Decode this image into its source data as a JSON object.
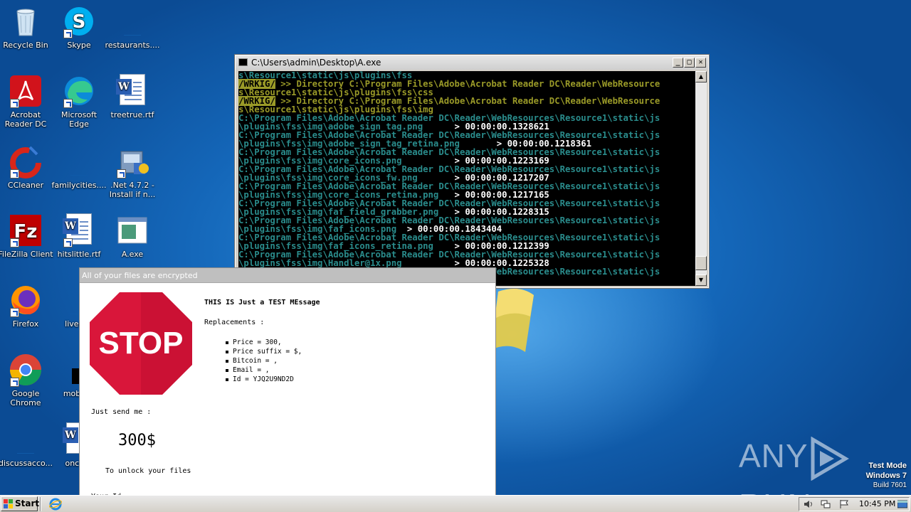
{
  "desktop": {
    "icons": [
      {
        "label": "Recycle Bin",
        "icon": "recycle-bin-icon"
      },
      {
        "label": "Skype",
        "icon": "skype-icon"
      },
      {
        "label": "restaurants....",
        "icon": "blank-file-icon"
      },
      {
        "label": "Acrobat Reader DC",
        "icon": "acrobat-reader-icon"
      },
      {
        "label": "Microsoft Edge",
        "icon": "edge-icon"
      },
      {
        "label": "treetrue.rtf",
        "icon": "word-doc-icon"
      },
      {
        "label": "CCleaner",
        "icon": "ccleaner-icon"
      },
      {
        "label": "familycities....",
        "icon": "blank-file-icon"
      },
      {
        "label": ".Net 4.7.2 - Install if n...",
        "icon": "installer-icon"
      },
      {
        "label": "FileZilla Client",
        "icon": "filezilla-icon"
      },
      {
        "label": "hitslittle.rtf",
        "icon": "word-doc-icon"
      },
      {
        "label": "A.exe",
        "icon": "exe-window-icon"
      },
      {
        "label": "Firefox",
        "icon": "firefox-icon"
      },
      {
        "label": "liveenv",
        "icon": "blank-file-icon"
      },
      {
        "label": "Google Chrome",
        "icon": "chrome-icon"
      },
      {
        "label": "mobiled",
        "icon": "black-file-icon"
      },
      {
        "label": "discussacco...",
        "icon": "blank-file-icon"
      },
      {
        "label": "oncese",
        "icon": "word-doc-icon"
      }
    ]
  },
  "console": {
    "title": "C:\\Users\\admin\\Desktop\\A.exe",
    "lines": [
      {
        "tag": "",
        "text": "s\\Resource1\\static\\js\\plugins\\fss",
        "color": "teal"
      },
      {
        "tag": "/WRKIG/",
        "text": " >> Directory C:\\Program Files\\Adobe\\Acrobat Reader DC\\Reader\\WebResource",
        "color": "olive"
      },
      {
        "tag": "",
        "text": "s\\Resource1\\static\\js\\plugins\\fss\\css",
        "color": "olive"
      },
      {
        "tag": "/WRKIG/",
        "text": " >> Directory C:\\Program Files\\Adobe\\Acrobat Reader DC\\Reader\\WebResource",
        "color": "olive"
      },
      {
        "tag": "",
        "text": "s\\Resource1\\static\\js\\plugins\\fss\\img",
        "color": "olive"
      },
      {
        "tag": "",
        "text": "C:\\Program Files\\Adobe\\Acrobat Reader DC\\Reader\\WebResources\\Resource1\\static\\js",
        "color": "teal"
      },
      {
        "tag": "",
        "text": "\\plugins\\fss\\img\\adobe_sign_tag.png",
        "color": "teal",
        "time": "      > 00:00:00.1328621"
      },
      {
        "tag": "",
        "text": "C:\\Program Files\\Adobe\\Acrobat Reader DC\\Reader\\WebResources\\Resource1\\static\\js",
        "color": "teal"
      },
      {
        "tag": "",
        "text": "\\plugins\\fss\\img\\adobe_sign_tag_retina.png",
        "color": "teal",
        "time": "       > 00:00:00.1218361"
      },
      {
        "tag": "",
        "text": "C:\\Program Files\\Adobe\\Acrobat Reader DC\\Reader\\WebResources\\Resource1\\static\\js",
        "color": "teal"
      },
      {
        "tag": "",
        "text": "\\plugins\\fss\\img\\core_icons.png",
        "color": "teal",
        "time": "          > 00:00:00.1223169"
      },
      {
        "tag": "",
        "text": "C:\\Program Files\\Adobe\\Acrobat Reader DC\\Reader\\WebResources\\Resource1\\static\\js",
        "color": "teal"
      },
      {
        "tag": "",
        "text": "\\plugins\\fss\\img\\core_icons_fw.png",
        "color": "teal",
        "time": "       > 00:00:00.1217207"
      },
      {
        "tag": "",
        "text": "C:\\Program Files\\Adobe\\Acrobat Reader DC\\Reader\\WebResources\\Resource1\\static\\js",
        "color": "teal"
      },
      {
        "tag": "",
        "text": "\\plugins\\fss\\img\\core_icons_retina.png",
        "color": "teal",
        "time": "   > 00:00:00.1217165"
      },
      {
        "tag": "",
        "text": "C:\\Program Files\\Adobe\\Acrobat Reader DC\\Reader\\WebResources\\Resource1\\static\\js",
        "color": "teal"
      },
      {
        "tag": "",
        "text": "\\plugins\\fss\\img\\faf_field_grabber.png",
        "color": "teal",
        "time": "   > 00:00:00.1228315"
      },
      {
        "tag": "",
        "text": "C:\\Program Files\\Adobe\\Acrobat Reader DC\\Reader\\WebResources\\Resource1\\static\\js",
        "color": "teal"
      },
      {
        "tag": "",
        "text": "\\plugins\\fss\\img\\faf_icons.png",
        "color": "teal",
        "time": "  > 00:00:00.1843404"
      },
      {
        "tag": "",
        "text": "C:\\Program Files\\Adobe\\Acrobat Reader DC\\Reader\\WebResources\\Resource1\\static\\js",
        "color": "teal"
      },
      {
        "tag": "",
        "text": "\\plugins\\fss\\img\\faf_icons_retina.png",
        "color": "teal",
        "time": "    > 00:00:00.1212399"
      },
      {
        "tag": "",
        "text": "C:\\Program Files\\Adobe\\Acrobat Reader DC\\Reader\\WebResources\\Resource1\\static\\js",
        "color": "teal"
      },
      {
        "tag": "",
        "text": "\\plugins\\fss\\img\\Handler@1x.png",
        "color": "teal",
        "time": "          > 00:00:00.1225328"
      },
      {
        "tag": "",
        "text": "C:\\Program Files\\Adobe\\Acrobat Reader DC\\Reader\\WebResources\\Resource1\\static\\js",
        "color": "teal"
      }
    ],
    "colors": {
      "teal": "#2a8c8c",
      "olive": "#9a9a28",
      "white": "#ffffff"
    }
  },
  "ransom": {
    "title": "All of your files are encrypted",
    "stop_sign_text": "STOP",
    "message": "THIS IS Just a TEST MEssage",
    "replacements_label": "Replacements :",
    "replacements": [
      "Price = 300,",
      "Price suffix = $,",
      "Bitcoin = ,",
      "Email = ,",
      "Id = YJQ2U9ND2D"
    ],
    "send_label": "Just send me :",
    "amount": "300$",
    "unlock_text": "To unlock your files",
    "your_id_label": "Your Id :",
    "stop_color": "#d9163a"
  },
  "watermark": {
    "anyrun_left": "ANY",
    "anyrun_right": "RUN",
    "test_mode": "Test Mode",
    "os": "Windows 7",
    "build": "Build 7601"
  },
  "taskbar": {
    "start_label": "Start",
    "clock": "10:45 PM"
  }
}
